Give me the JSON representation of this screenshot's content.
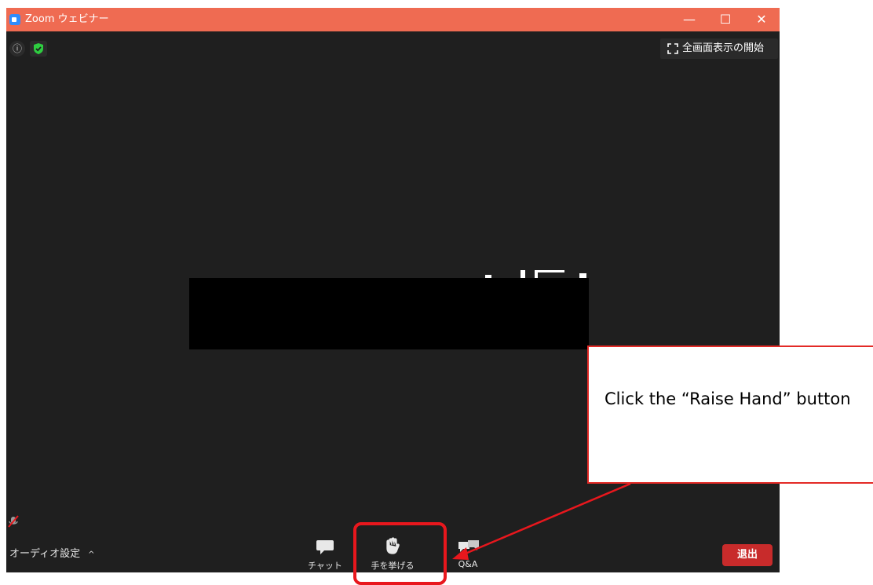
{
  "window": {
    "title": "Zoom ウェビナー",
    "controls": {
      "minimize": "—",
      "maximize": "☐",
      "close": "✕"
    }
  },
  "top_bar": {
    "info_icon": "ⓘ",
    "fullscreen_label": "全画面表示の開始"
  },
  "bottom_bar": {
    "audio_settings_label": "オーディオ設定",
    "audio_chevron": "^",
    "chat_label": "チャット",
    "raise_hand_label": "手を挙げる",
    "qa_label": "Q&A",
    "leave_label": "退出"
  },
  "annotation": {
    "callout_text": "Click the “Raise Hand” button"
  },
  "icons": {
    "app": "zoom-camera-icon",
    "security": "shield-check-icon",
    "fullscreen": "fullscreen-corners-icon",
    "mic": "mic-muted-icon",
    "chat": "chat-bubble-icon",
    "raise_hand": "hand-icon",
    "qa": "qa-bubbles-icon"
  },
  "colors": {
    "titlebar": "#ef6b52",
    "window_bg": "#1f1f1f",
    "leave_button": "#c82b2b",
    "annotation_red": "#e8171d",
    "shield_green": "#2ecc40"
  }
}
